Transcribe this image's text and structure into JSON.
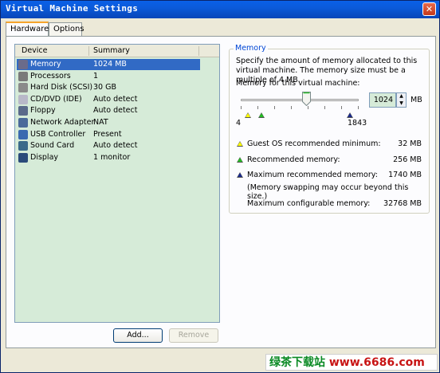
{
  "window": {
    "title": "Virtual Machine Settings",
    "close_glyph": "✕"
  },
  "tabs": [
    {
      "label": "Hardware",
      "active": true
    },
    {
      "label": "Options",
      "active": false
    }
  ],
  "device_list": {
    "columns": [
      "Device",
      "Summary"
    ],
    "rows": [
      {
        "device": "Memory",
        "summary": "1024 MB",
        "icon": "memory-icon",
        "selected": true
      },
      {
        "device": "Processors",
        "summary": "1",
        "icon": "processor-icon",
        "selected": false
      },
      {
        "device": "Hard Disk (SCSI)",
        "summary": "30 GB",
        "icon": "hard-disk-icon",
        "selected": false
      },
      {
        "device": "CD/DVD (IDE)",
        "summary": "Auto detect",
        "icon": "cd-dvd-icon",
        "selected": false
      },
      {
        "device": "Floppy",
        "summary": "Auto detect",
        "icon": "floppy-icon",
        "selected": false
      },
      {
        "device": "Network Adapter",
        "summary": "NAT",
        "icon": "network-adapter-icon",
        "selected": false
      },
      {
        "device": "USB Controller",
        "summary": "Present",
        "icon": "usb-icon",
        "selected": false
      },
      {
        "device": "Sound Card",
        "summary": "Auto detect",
        "icon": "sound-card-icon",
        "selected": false
      },
      {
        "device": "Display",
        "summary": "1 monitor",
        "icon": "display-icon",
        "selected": false
      }
    ],
    "add_label": "Add...",
    "remove_label": "Remove"
  },
  "memory": {
    "group_title": "Memory",
    "description": "Specify the amount of memory allocated to this virtual machine. The memory size must be a multiple of 4 MB.",
    "field_label": "Memory for this virtual machine:",
    "value": "1024",
    "unit": "MB",
    "slider_min_label": "4",
    "slider_max_label": "1843",
    "guest_os_min_label": "Guest OS recommended minimum:",
    "guest_os_min_value": "32 MB",
    "recommended_label": "Recommended memory:",
    "recommended_value": "256 MB",
    "max_recommended_label": "Maximum recommended memory:",
    "max_recommended_value": "1740 MB",
    "swap_note": "(Memory swapping may occur beyond this size.)",
    "max_configurable_label": "Maximum configurable memory:",
    "max_configurable_value": "32768 MB"
  },
  "watermark": {
    "cn": "绿茶下载站",
    "site": "www.6686.com"
  },
  "colors": {
    "titlebar": "#0a5ad9",
    "selection": "#316ac5",
    "list_bg": "#d6ebd8",
    "guest_min_marker": "#ffff00",
    "recommended_marker": "#22bb22",
    "max_marker": "#1a2a8c"
  }
}
